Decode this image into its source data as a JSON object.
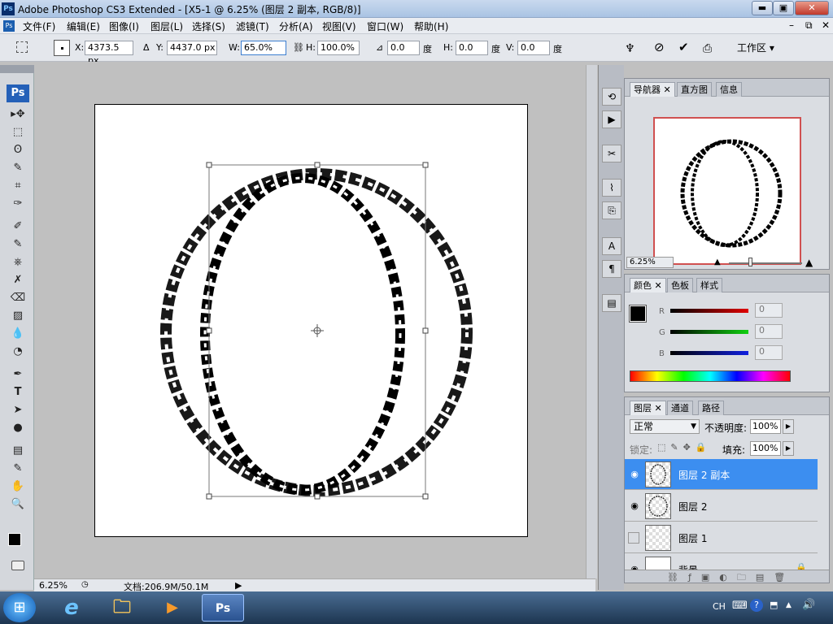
{
  "window": {
    "app_icon": "Ps",
    "title": "Adobe Photoshop CS3 Extended - [X5-1 @ 6.25% (图层 2 副本, RGB/8)]",
    "min_glyph": "▬",
    "max_glyph": "▣",
    "close_glyph": "✕"
  },
  "menu": [
    "文件(F)",
    "编辑(E)",
    "图像(I)",
    "图层(L)",
    "选择(S)",
    "滤镜(T)",
    "分析(A)",
    "视图(V)",
    "窗口(W)",
    "帮助(H)"
  ],
  "doc_controls": [
    "–",
    "⧉",
    "✕"
  ],
  "options": {
    "x_label": "X:",
    "x_value": "4373.5 px",
    "delta_symbol": "Δ",
    "y_label": "Y:",
    "y_value": "4437.0 px",
    "w_label": "W:",
    "w_value": "65.0%",
    "h_label": "H:",
    "h_value": "100.0%",
    "angle_value": "0.0",
    "angle_unit": "度",
    "hskew_label": "H:",
    "hskew_value": "0.0",
    "hskew_unit": "度",
    "vskew_label": "V:",
    "vskew_value": "0.0",
    "vskew_unit": "度",
    "workspace_label": "工作区 ▾",
    "cancel_glyph": "⃠",
    "commit_glyph": "✔"
  },
  "toolbox": {
    "logo": "Ps",
    "tools": [
      "▸✥",
      "⬚",
      "ʘ",
      "✎",
      "⌗",
      "✑",
      "✐",
      "✎",
      "⎈",
      "✗",
      "⌫",
      "▨",
      "💧",
      "◔",
      "✒",
      "T",
      "➤",
      "●",
      "▤",
      "✎",
      "✋",
      "🔍"
    ]
  },
  "status": {
    "zoom": "6.25%",
    "doc_info": "文档:206.9M/50.1M",
    "arrow": "▶"
  },
  "navigator": {
    "tabs": [
      "导航器",
      "直方图",
      "信息"
    ],
    "zoom": "6.25%"
  },
  "color_panel": {
    "tabs": [
      "颜色",
      "色板",
      "样式"
    ],
    "r_label": "R",
    "g_label": "G",
    "b_label": "B",
    "r_value": "0",
    "g_value": "0",
    "b_value": "0"
  },
  "layers_panel": {
    "tabs": [
      "图层",
      "通道",
      "路径"
    ],
    "blend_mode": "正常",
    "opacity_label": "不透明度:",
    "opacity_value": "100%",
    "lock_label": "锁定:",
    "fill_label": "填充:",
    "fill_value": "100%",
    "layers": [
      {
        "name": "图层 2 副本",
        "visible": true,
        "selected": true
      },
      {
        "name": "图层 2",
        "visible": true,
        "selected": false
      },
      {
        "name": "图层 1",
        "visible": false,
        "selected": false
      },
      {
        "name": "背景",
        "visible": true,
        "selected": false
      }
    ]
  },
  "taskbar": {
    "items": [
      "⊞",
      "e",
      "🗀",
      "▶",
      "Ps"
    ],
    "tray_lang": "CH",
    "tray_icons": [
      "⌨",
      "?",
      "▲",
      "🔊"
    ]
  },
  "colors": {
    "accent": "#3c8ef0",
    "canvas_bg": "#c0c0c0"
  }
}
